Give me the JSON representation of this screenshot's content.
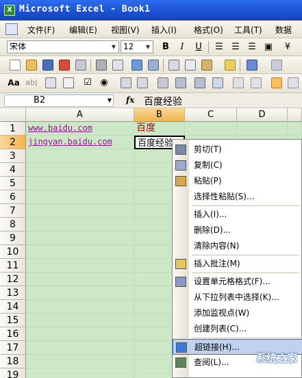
{
  "window": {
    "title": "Microsoft Excel - Book1",
    "app_icon": "X"
  },
  "menubar": {
    "items": [
      "文件(F)",
      "编辑(E)",
      "视图(V)",
      "插入(I)",
      "格式(O)",
      "工具(T)",
      "数据"
    ]
  },
  "format_toolbar": {
    "font_name": "宋体",
    "font_size": "12",
    "bold": "B",
    "italic": "I",
    "underline": "U"
  },
  "formula_bar": {
    "name_box": "B2",
    "fx": "fx",
    "content": "百度经验"
  },
  "sheet": {
    "columns": [
      "A",
      "B",
      "C",
      "D"
    ],
    "rows": [
      "1",
      "2",
      "3",
      "4",
      "5",
      "6",
      "7",
      "8",
      "9",
      "10",
      "11",
      "12",
      "13",
      "14",
      "15",
      "16",
      "17",
      "18",
      "19"
    ],
    "cells": {
      "A1": "www.baidu.com",
      "B1": "百度",
      "A2": "jingyan.baidu.com",
      "B2": "百度经验"
    },
    "active_cell": "B2"
  },
  "context_menu": {
    "items": [
      {
        "label": "剪切(T)",
        "icon": "scissors-icon"
      },
      {
        "label": "复制(C)",
        "icon": "copy-icon"
      },
      {
        "label": "粘贴(P)",
        "icon": "paste-icon"
      },
      {
        "label": "选择性粘贴(S)...",
        "icon": ""
      },
      {
        "label": "插入(I)...",
        "icon": ""
      },
      {
        "label": "删除(D)...",
        "icon": ""
      },
      {
        "label": "清除内容(N)",
        "icon": ""
      },
      {
        "label": "插入批注(M)",
        "icon": "comment-icon"
      },
      {
        "label": "设置单元格格式(F)...",
        "icon": "format-cells-icon"
      },
      {
        "label": "从下拉列表中选择(K)...",
        "icon": ""
      },
      {
        "label": "添加监视点(W)",
        "icon": ""
      },
      {
        "label": "创建列表(C)...",
        "icon": ""
      },
      {
        "label": "超链接(H)...",
        "icon": "hyperlink-icon"
      },
      {
        "label": "查阅(L)...",
        "icon": "lookup-icon"
      }
    ],
    "highlighted": "超链接(H)..."
  },
  "watermark": "系统之家",
  "colors": {
    "title_bar": "#1a4fd0",
    "cell_fill": "#cde8c7",
    "link_text": "#8b1a8b",
    "red_text": "#c00000",
    "highlight": "#c1d2ee"
  }
}
